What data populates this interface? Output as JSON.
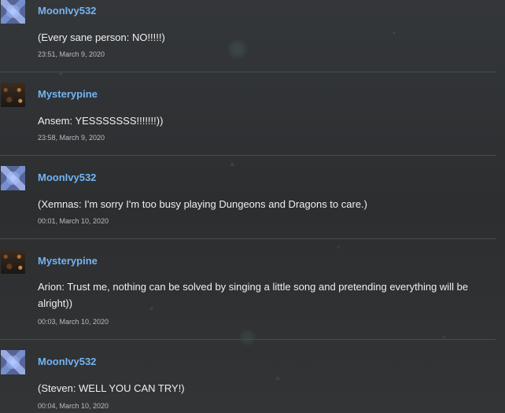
{
  "messages": [
    {
      "author": "MoonIvy532",
      "avatar_icon": "diamond-pattern-avatar",
      "text": "(Every sane person: NO!!!!!)",
      "time": "23:51, March 9, 2020"
    },
    {
      "author": "Mysterypine",
      "avatar_icon": "dark-photo-avatar",
      "text": "Ansem: YESSSSSSS!!!!!!!))",
      "time": "23:58, March 9, 2020"
    },
    {
      "author": "MoonIvy532",
      "avatar_icon": "diamond-pattern-avatar",
      "text": "(Xemnas: I'm sorry I'm too busy playing Dungeons and Dragons to care.)",
      "time": "00:01, March 10, 2020"
    },
    {
      "author": "Mysterypine",
      "avatar_icon": "dark-photo-avatar",
      "text": "Arion: Trust me, nothing can be solved by singing a little song and pretending everything will be alright))",
      "time": "00:03, March 10, 2020"
    },
    {
      "author": "MoonIvy532",
      "avatar_icon": "diamond-pattern-avatar",
      "text": "(Steven: WELL YOU CAN TRY!)",
      "time": "00:04, March 10, 2020"
    }
  ],
  "colors": {
    "background": "#2f3133",
    "username": "#73b4f4",
    "text": "#efefef",
    "timestamp": "#bdbdbd",
    "divider": "#4a4c4f"
  }
}
